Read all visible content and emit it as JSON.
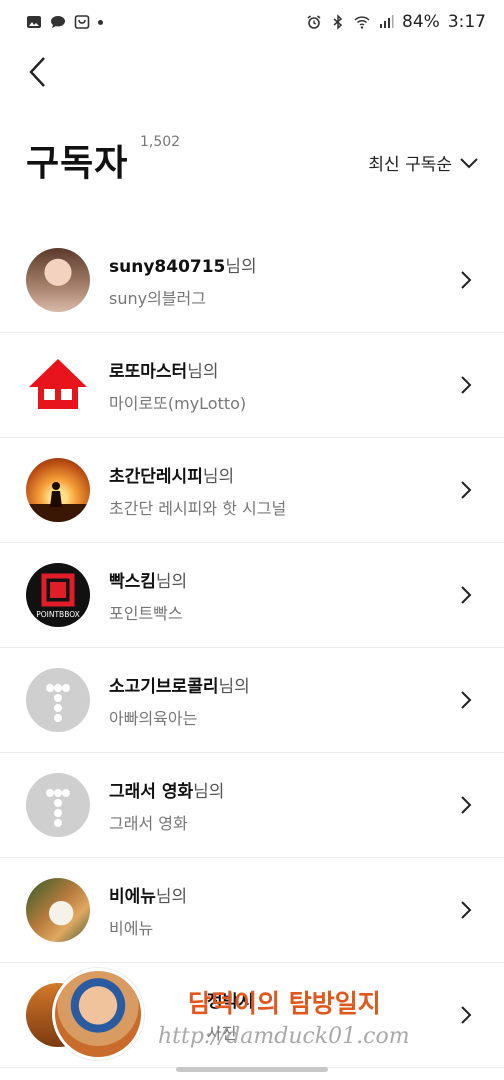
{
  "status": {
    "battery": "84%",
    "time": "3:17"
  },
  "header": {
    "title": "구독자",
    "count": "1,502",
    "sort_label": "최신 구독순"
  },
  "suffix": "님의",
  "subscribers": [
    {
      "name": "suny840715",
      "blog": "suny의블러그"
    },
    {
      "name": "로또마스터",
      "blog": "마이로또(myLotto)"
    },
    {
      "name": "초간단레시피",
      "blog": "초간단 레시피와 핫 시그널"
    },
    {
      "name": "빡스킴",
      "blog": "포인트빡스"
    },
    {
      "name": "소고기브로콜리",
      "blog": "아빠의육아는"
    },
    {
      "name": "그래서 영화",
      "blog": "그래서 영화"
    },
    {
      "name": "비에뉴",
      "blog": "비에뉴"
    },
    {
      "name": "정박시",
      "blog": "사진"
    }
  ],
  "avatars": {
    "box_text": "POINTBBOX"
  },
  "watermark": {
    "title": "담덕이의 탐방일지",
    "url": "http://damduck01.com"
  }
}
